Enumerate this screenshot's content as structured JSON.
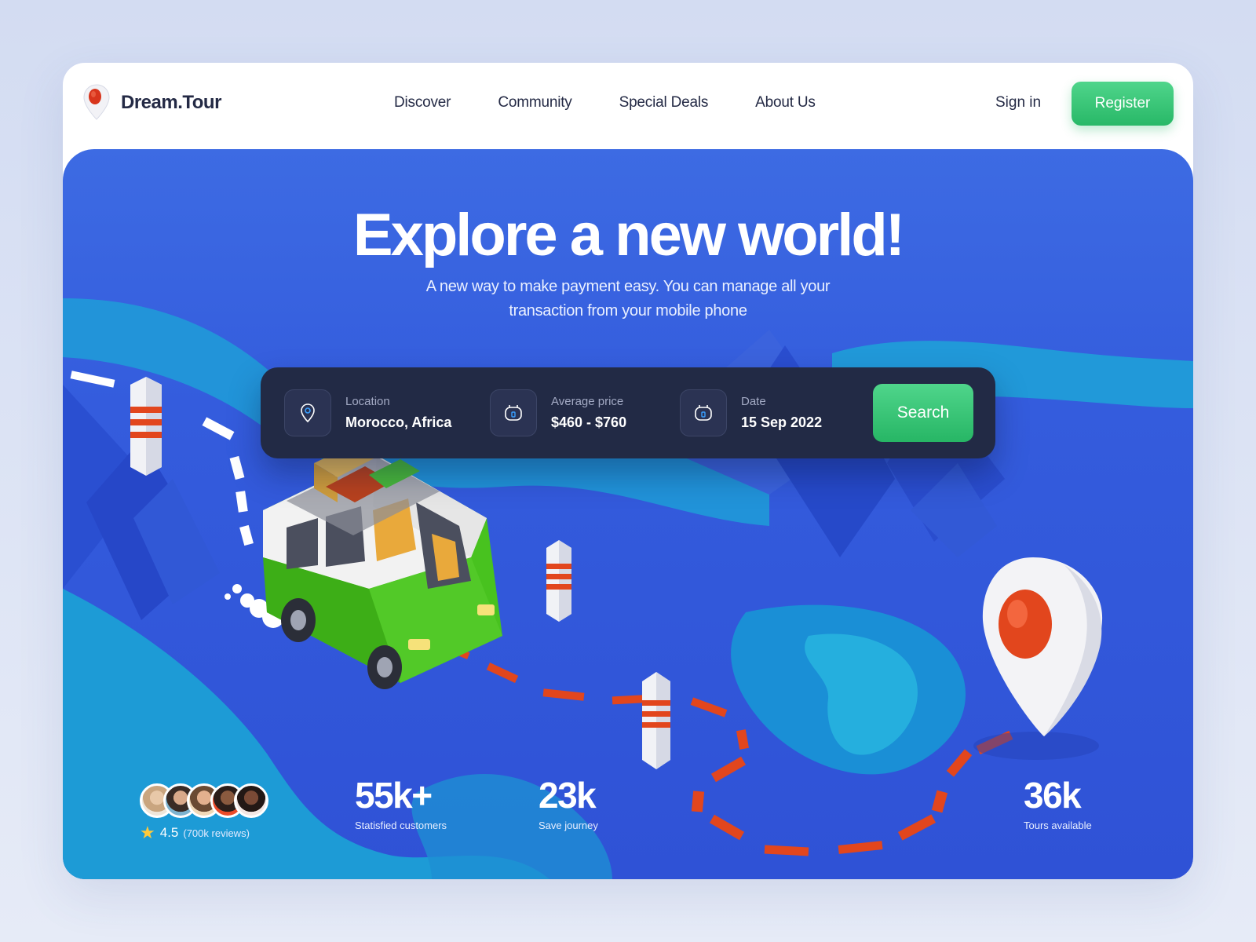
{
  "brand": {
    "name": "Dream.Tour"
  },
  "nav": {
    "items": [
      "Discover",
      "Community",
      "Special Deals",
      "About Us"
    ],
    "sign_in": "Sign in",
    "register": "Register"
  },
  "hero": {
    "title": "Explore a new world!",
    "subtitle_line1": "A new way to make payment easy. You can manage all your",
    "subtitle_line2": "transaction from your mobile phone"
  },
  "search": {
    "fields": [
      {
        "label": "Location",
        "value": "Morocco, Africa",
        "icon": "location-pin-icon"
      },
      {
        "label": "Average price",
        "value": "$460 - $760",
        "icon": "wallet-icon"
      },
      {
        "label": "Date",
        "value": "15 Sep 2022",
        "icon": "calendar-icon"
      }
    ],
    "button": "Search"
  },
  "stats": {
    "rating": {
      "value": "4.5",
      "count": "(700k reviews)"
    },
    "items": [
      {
        "number": "55k+",
        "label": "Statisfied customers"
      },
      {
        "number": "23k",
        "label": "Save journey"
      },
      {
        "number": "36k",
        "label": "Tours available"
      }
    ]
  },
  "colors": {
    "brand_dark": "#242a45",
    "accent_green": "#28b867",
    "hero_blue": "#345cdd",
    "searchbar_bg": "#222a45",
    "pin_red": "#e2461d"
  }
}
